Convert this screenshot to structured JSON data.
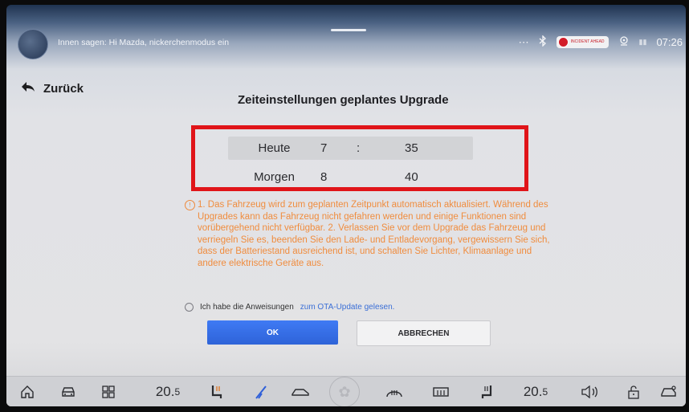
{
  "status_bar": {
    "voice_hint": "Innen sagen: Hi Mazda, nickerchenmodus ein",
    "more_icon": "⋯",
    "bluetooth_icon": "bluetooth-icon",
    "badge_text": "INCIDENT AHEAD",
    "location_icon": "location-icon",
    "signal_icon": "signal-icon",
    "time": "07:26"
  },
  "nav": {
    "back_label": "Zurück"
  },
  "dialog": {
    "title": "Zeiteinstellungen geplantes Upgrade",
    "picker_rows": [
      {
        "day": "Heute",
        "hour": "7",
        "separator": ":",
        "minute": "35"
      },
      {
        "day": "Morgen",
        "hour": "8",
        "separator": "",
        "minute": "40"
      }
    ],
    "notice_text": "1. Das Fahrzeug wird zum geplanten Zeitpunkt automatisch aktualisiert. Während des Upgrades kann das Fahrzeug nicht gefahren werden und einige Funktionen sind vorübergehend nicht verfügbar. 2. Verlassen Sie vor dem Upgrade das Fahrzeug und verriegeln Sie es, beenden Sie den Lade- und Entladevorgang, vergewissern Sie sich, dass der Batteriestand ausreichend ist, und schalten Sie Lichter, Klimaanlage und andere elektrische Geräte aus.",
    "consent_text": "Ich habe die Anweisungen",
    "consent_link": "zum OTA-Update gelesen.",
    "ok_label": "OK",
    "cancel_label": "ABBRECHEN"
  },
  "dock": {
    "left_temp_whole": "20.",
    "left_temp_frac": "5",
    "right_temp_whole": "20.",
    "right_temp_frac": "5",
    "icons": [
      "home-icon",
      "car-icon",
      "grid-icon",
      "seat-heat-left-icon",
      "wiper-icon",
      "car-fan-icon",
      "fan-icon",
      "front-defrost-icon",
      "rear-defrost-icon",
      "seat-heat-right-icon",
      "volume-icon",
      "lock-icon",
      "car-settings-icon"
    ]
  },
  "colors": {
    "highlight_border": "#e01419",
    "notice": "#f08c3e",
    "ok_button": "#3f7af4",
    "link": "#3b6fd6"
  }
}
